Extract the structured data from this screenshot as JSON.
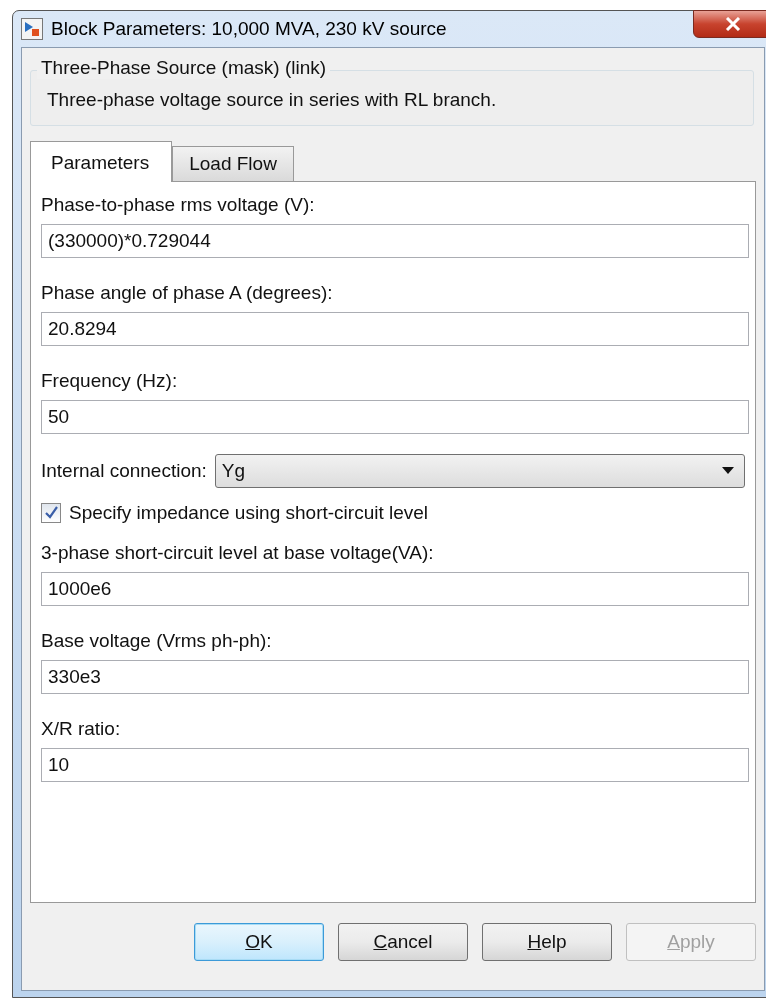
{
  "window": {
    "title": "Block Parameters: 10,000 MVA, 230 kV source"
  },
  "group": {
    "title": "Three-Phase Source (mask) (link)",
    "description": "Three-phase voltage source in series with RL branch."
  },
  "tabs": [
    {
      "label": "Parameters",
      "selected": true
    },
    {
      "label": "Load Flow",
      "selected": false
    }
  ],
  "parameters": [
    {
      "kind": "field",
      "label": "Phase-to-phase rms voltage (V):",
      "value": "(330000)*0.729044"
    },
    {
      "kind": "field",
      "label": "Phase angle of phase A (degrees):",
      "value": "20.8294"
    },
    {
      "kind": "field",
      "label": "Frequency (Hz):",
      "value": "50"
    },
    {
      "kind": "dropdown",
      "label": "Internal connection:",
      "value": "Yg"
    },
    {
      "kind": "checkbox",
      "label": "Specify impedance using short-circuit level",
      "checked": true
    },
    {
      "kind": "field",
      "label": "3-phase short-circuit level at base voltage(VA):",
      "value": "1000e6"
    },
    {
      "kind": "field",
      "label": "Base voltage (Vrms ph-ph):",
      "value": "330e3"
    },
    {
      "kind": "field",
      "label": "X/R ratio:",
      "value": "10"
    }
  ],
  "buttons": [
    {
      "label": "OK",
      "default": true,
      "disabled": false
    },
    {
      "label": "Cancel",
      "default": false,
      "disabled": false
    },
    {
      "label": "Help",
      "default": false,
      "disabled": false
    },
    {
      "label": "Apply",
      "default": false,
      "disabled": true
    }
  ]
}
